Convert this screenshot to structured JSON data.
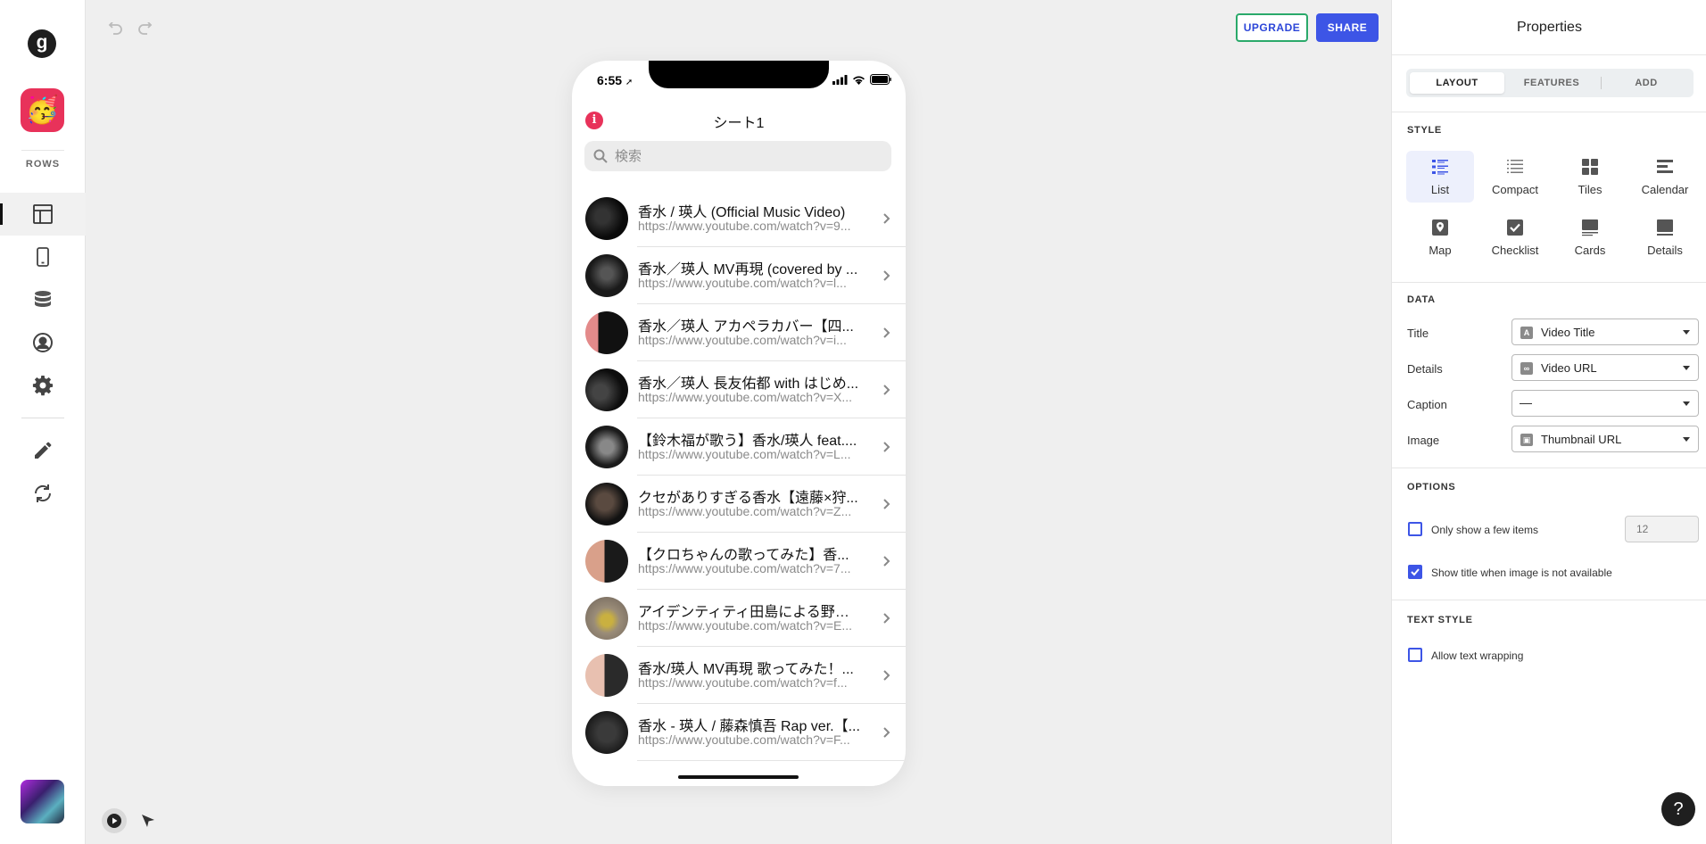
{
  "leftnav": {
    "logo": "g",
    "app_emoji": "🥳",
    "rows_label": "ROWS"
  },
  "toolbar": {
    "upgrade_label": "UPGRADE",
    "share_label": "SHARE"
  },
  "phone": {
    "time": "6:55",
    "info_glyph": "i",
    "sheet_title": "シート1",
    "search_placeholder": "検索",
    "items": [
      {
        "title": "香水 / 瑛人 (Official Music Video)",
        "url": "https://www.youtube.com/watch?v=9..."
      },
      {
        "title": "香水／瑛人 MV再現 (covered by ...",
        "url": "https://www.youtube.com/watch?v=l..."
      },
      {
        "title": "香水／瑛人 アカペラカバー【四...",
        "url": "https://www.youtube.com/watch?v=i..."
      },
      {
        "title": "香水／瑛人 長友佑都 with はじめ...",
        "url": "https://www.youtube.com/watch?v=X..."
      },
      {
        "title": "【鈴木福が歌う】香水/瑛人 feat....",
        "url": "https://www.youtube.com/watch?v=L..."
      },
      {
        "title": "クセがありすぎる香水【遠藤×狩...",
        "url": "https://www.youtube.com/watch?v=Z..."
      },
      {
        "title": "【クロちゃんの歌ってみた】香...",
        "url": "https://www.youtube.com/watch?v=7..."
      },
      {
        "title": "アイデンティティ田島による野沢...",
        "url": "https://www.youtube.com/watch?v=E..."
      },
      {
        "title": "香水/瑛人 MV再現 歌ってみた！...",
        "url": "https://www.youtube.com/watch?v=f..."
      },
      {
        "title": "香水 - 瑛人 / 藤森慎吾 Rap ver.【...",
        "url": "https://www.youtube.com/watch?v=F..."
      }
    ]
  },
  "props": {
    "title": "Properties",
    "tabs": [
      "LAYOUT",
      "FEATURES",
      "ADD"
    ],
    "active_tab": "LAYOUT",
    "style_header": "STYLE",
    "styles": [
      "List",
      "Compact",
      "Tiles",
      "Calendar",
      "Map",
      "Checklist",
      "Cards",
      "Details"
    ],
    "active_style": "List",
    "data_header": "DATA",
    "fields": [
      {
        "label": "Title",
        "value": "Video Title",
        "icon_glyph": "A"
      },
      {
        "label": "Details",
        "value": "Video URL",
        "icon_glyph": "∞"
      },
      {
        "label": "Caption",
        "value": "—",
        "icon_glyph": ""
      },
      {
        "label": "Image",
        "value": "Thumbnail URL",
        "icon_glyph": "▣"
      }
    ],
    "options_header": "OPTIONS",
    "opt_few_items": "Only show a few items",
    "opt_few_items_value": "12",
    "opt_few_items_checked": false,
    "opt_show_title": "Show title when image is not available",
    "opt_show_title_checked": true,
    "text_style_header": "TEXT STYLE",
    "opt_wrap": "Allow text wrapping",
    "opt_wrap_checked": false,
    "help_glyph": "?"
  },
  "colors": {
    "accent": "#3d55e6",
    "upgrade_border": "#2aa96a",
    "app_icon": "#e8325a"
  }
}
